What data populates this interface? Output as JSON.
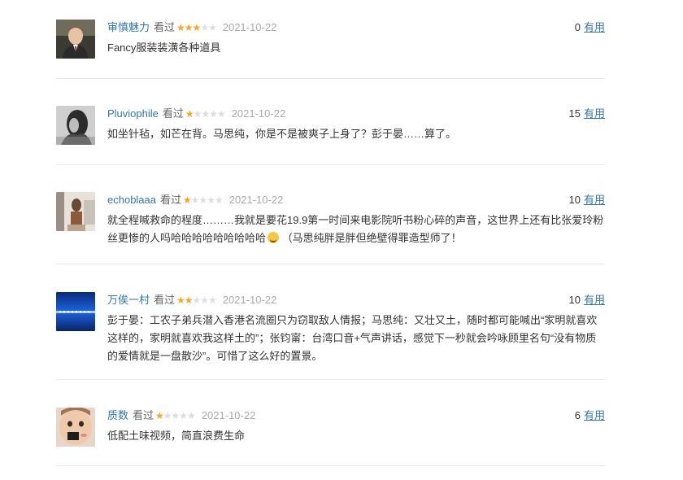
{
  "reviews": [
    {
      "user": "审慎魅力",
      "watched": "看过",
      "rating": 3,
      "date": "2021-10-22",
      "votes": "0",
      "useful": "有用",
      "content": "Fancy服装装潢各种道具"
    },
    {
      "user": "Pluviophile",
      "watched": "看过",
      "rating": 1,
      "date": "2021-10-22",
      "votes": "15",
      "useful": "有用",
      "content": "如坐针毡，如芒在背。马思纯，你是不是被爽子上身了？彭于晏……算了。"
    },
    {
      "user": "echoblaaa",
      "watched": "看过",
      "rating": 1,
      "date": "2021-10-22",
      "votes": "10",
      "useful": "有用",
      "content": "就全程喊救命的程度………我就是要花19.9第一时间来电影院听书粉心碎的声音，这世界上还有比张爱玲粉丝更惨的人吗哈哈哈哈哈哈哈哈哈",
      "content_tail": "（马思纯胖是胖但绝壁得罪造型师了！"
    },
    {
      "user": "万俟一村",
      "watched": "看过",
      "rating": 2,
      "date": "2021-10-22",
      "votes": "10",
      "useful": "有用",
      "content": "彭于晏：工农子弟兵潜入香港名流圈只为窃取敌人情报；马思纯：又壮又土，随时都可能喊出“家明就喜欢这样的，家明就喜欢我这样土的”；张钧甯：台湾口音+气声讲话，感觉下一秒就会吟咏顾里名句“没有物质的爱情就是一盘散沙”。可惜了这么好的置景。"
    },
    {
      "user": "质数",
      "watched": "看过",
      "rating": 1,
      "date": "2021-10-22",
      "votes": "6",
      "useful": "有用",
      "content": "低配土味视频，简直浪费生命"
    }
  ]
}
